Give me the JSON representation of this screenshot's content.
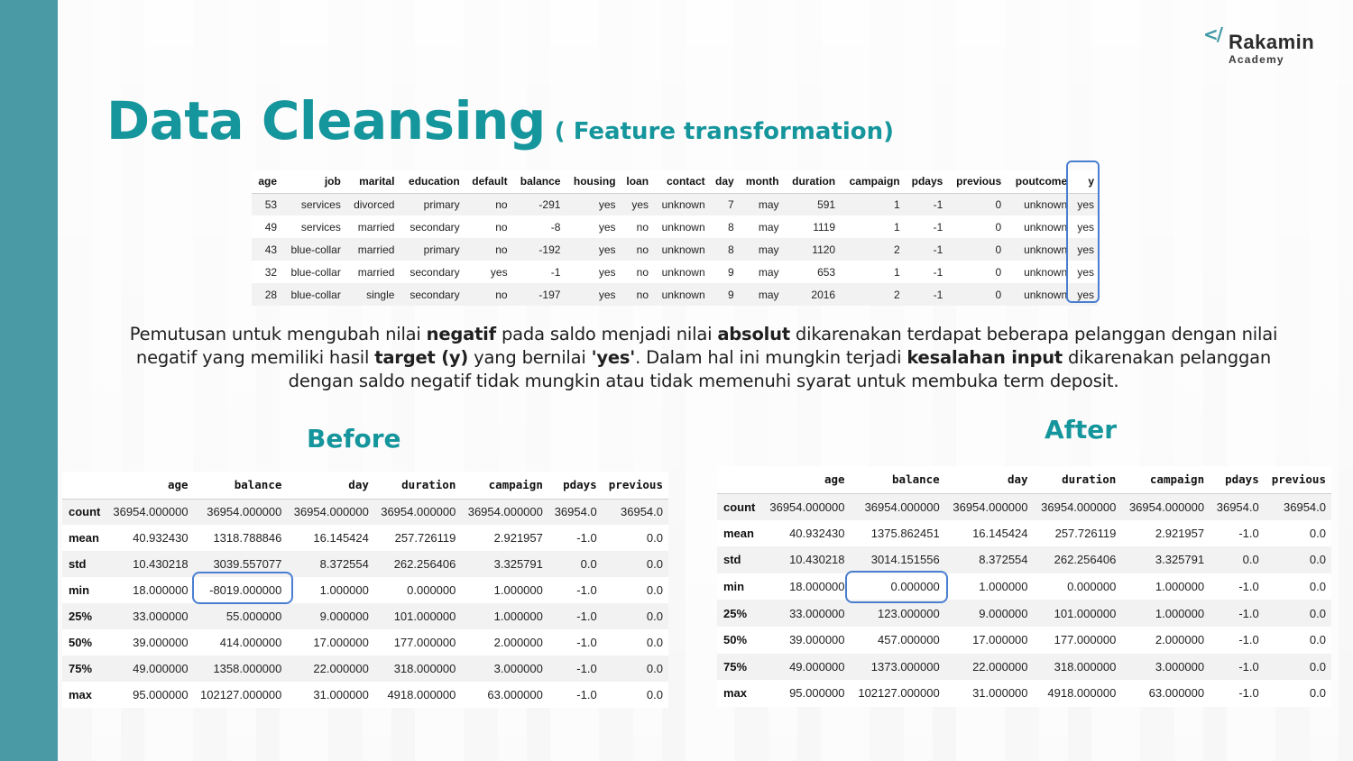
{
  "slide": {
    "title": "Data Cleansing",
    "subtitle": "( Feature transformation)"
  },
  "logo": {
    "mark": "</",
    "name": "Rakamin",
    "sub": "Academy"
  },
  "top_table": {
    "headers": [
      "age",
      "job",
      "marital",
      "education",
      "default",
      "balance",
      "housing",
      "loan",
      "contact",
      "day",
      "month",
      "duration",
      "campaign",
      "pdays",
      "previous",
      "poutcome",
      "y"
    ],
    "rows": [
      [
        "53",
        "services",
        "divorced",
        "primary",
        "no",
        "-291",
        "yes",
        "yes",
        "unknown",
        "7",
        "may",
        "591",
        "1",
        "-1",
        "0",
        "unknown",
        "yes"
      ],
      [
        "49",
        "services",
        "married",
        "secondary",
        "no",
        "-8",
        "yes",
        "no",
        "unknown",
        "8",
        "may",
        "1119",
        "1",
        "-1",
        "0",
        "unknown",
        "yes"
      ],
      [
        "43",
        "blue-collar",
        "married",
        "primary",
        "no",
        "-192",
        "yes",
        "no",
        "unknown",
        "8",
        "may",
        "1120",
        "2",
        "-1",
        "0",
        "unknown",
        "yes"
      ],
      [
        "32",
        "blue-collar",
        "married",
        "secondary",
        "yes",
        "-1",
        "yes",
        "no",
        "unknown",
        "9",
        "may",
        "653",
        "1",
        "-1",
        "0",
        "unknown",
        "yes"
      ],
      [
        "28",
        "blue-collar",
        "single",
        "secondary",
        "no",
        "-197",
        "yes",
        "no",
        "unknown",
        "9",
        "may",
        "2016",
        "2",
        "-1",
        "0",
        "unknown",
        "yes"
      ]
    ]
  },
  "description": {
    "p1": "Pemutusan untuk mengubah nilai ",
    "b1": "negatif",
    "p2": " pada saldo menjadi nilai ",
    "b2": "absolut",
    "p3": " dikarenakan terdapat beberapa pelanggan dengan nilai negatif yang memiliki hasil ",
    "b3": "target (y)",
    "p4": " yang bernilai ",
    "b4": "'yes'",
    "p5": ". Dalam hal ini mungkin terjadi ",
    "b5": "kesalahan input",
    "p6": " dikarenakan pelanggan dengan saldo negatif tidak mungkin atau tidak memenuhi syarat untuk membuka term deposit."
  },
  "before": {
    "label": "Before",
    "headers": [
      "",
      "age",
      "balance",
      "day",
      "duration",
      "campaign",
      "pdays",
      "previous"
    ],
    "rows": [
      [
        "count",
        "36954.000000",
        "36954.000000",
        "36954.000000",
        "36954.000000",
        "36954.000000",
        "36954.0",
        "36954.0"
      ],
      [
        "mean",
        "40.932430",
        "1318.788846",
        "16.145424",
        "257.726119",
        "2.921957",
        "-1.0",
        "0.0"
      ],
      [
        "std",
        "10.430218",
        "3039.557077",
        "8.372554",
        "262.256406",
        "3.325791",
        "0.0",
        "0.0"
      ],
      [
        "min",
        "18.000000",
        "-8019.000000",
        "1.000000",
        "0.000000",
        "1.000000",
        "-1.0",
        "0.0"
      ],
      [
        "25%",
        "33.000000",
        "55.000000",
        "9.000000",
        "101.000000",
        "1.000000",
        "-1.0",
        "0.0"
      ],
      [
        "50%",
        "39.000000",
        "414.000000",
        "17.000000",
        "177.000000",
        "2.000000",
        "-1.0",
        "0.0"
      ],
      [
        "75%",
        "49.000000",
        "1358.000000",
        "22.000000",
        "318.000000",
        "3.000000",
        "-1.0",
        "0.0"
      ],
      [
        "max",
        "95.000000",
        "102127.000000",
        "31.000000",
        "4918.000000",
        "63.000000",
        "-1.0",
        "0.0"
      ]
    ]
  },
  "after": {
    "label": "After",
    "headers": [
      "",
      "age",
      "balance",
      "day",
      "duration",
      "campaign",
      "pdays",
      "previous"
    ],
    "rows": [
      [
        "count",
        "36954.000000",
        "36954.000000",
        "36954.000000",
        "36954.000000",
        "36954.000000",
        "36954.0",
        "36954.0"
      ],
      [
        "mean",
        "40.932430",
        "1375.862451",
        "16.145424",
        "257.726119",
        "2.921957",
        "-1.0",
        "0.0"
      ],
      [
        "std",
        "10.430218",
        "3014.151556",
        "8.372554",
        "262.256406",
        "3.325791",
        "0.0",
        "0.0"
      ],
      [
        "min",
        "18.000000",
        "0.000000",
        "1.000000",
        "0.000000",
        "1.000000",
        "-1.0",
        "0.0"
      ],
      [
        "25%",
        "33.000000",
        "123.000000",
        "9.000000",
        "101.000000",
        "1.000000",
        "-1.0",
        "0.0"
      ],
      [
        "50%",
        "39.000000",
        "457.000000",
        "17.000000",
        "177.000000",
        "2.000000",
        "-1.0",
        "0.0"
      ],
      [
        "75%",
        "49.000000",
        "1373.000000",
        "22.000000",
        "318.000000",
        "3.000000",
        "-1.0",
        "0.0"
      ],
      [
        "max",
        "95.000000",
        "102127.000000",
        "31.000000",
        "4918.000000",
        "63.000000",
        "-1.0",
        "0.0"
      ]
    ]
  },
  "colors": {
    "accent": "#15959c",
    "sidebar": "#4a9aa6",
    "highlight": "#4a7fd0"
  }
}
